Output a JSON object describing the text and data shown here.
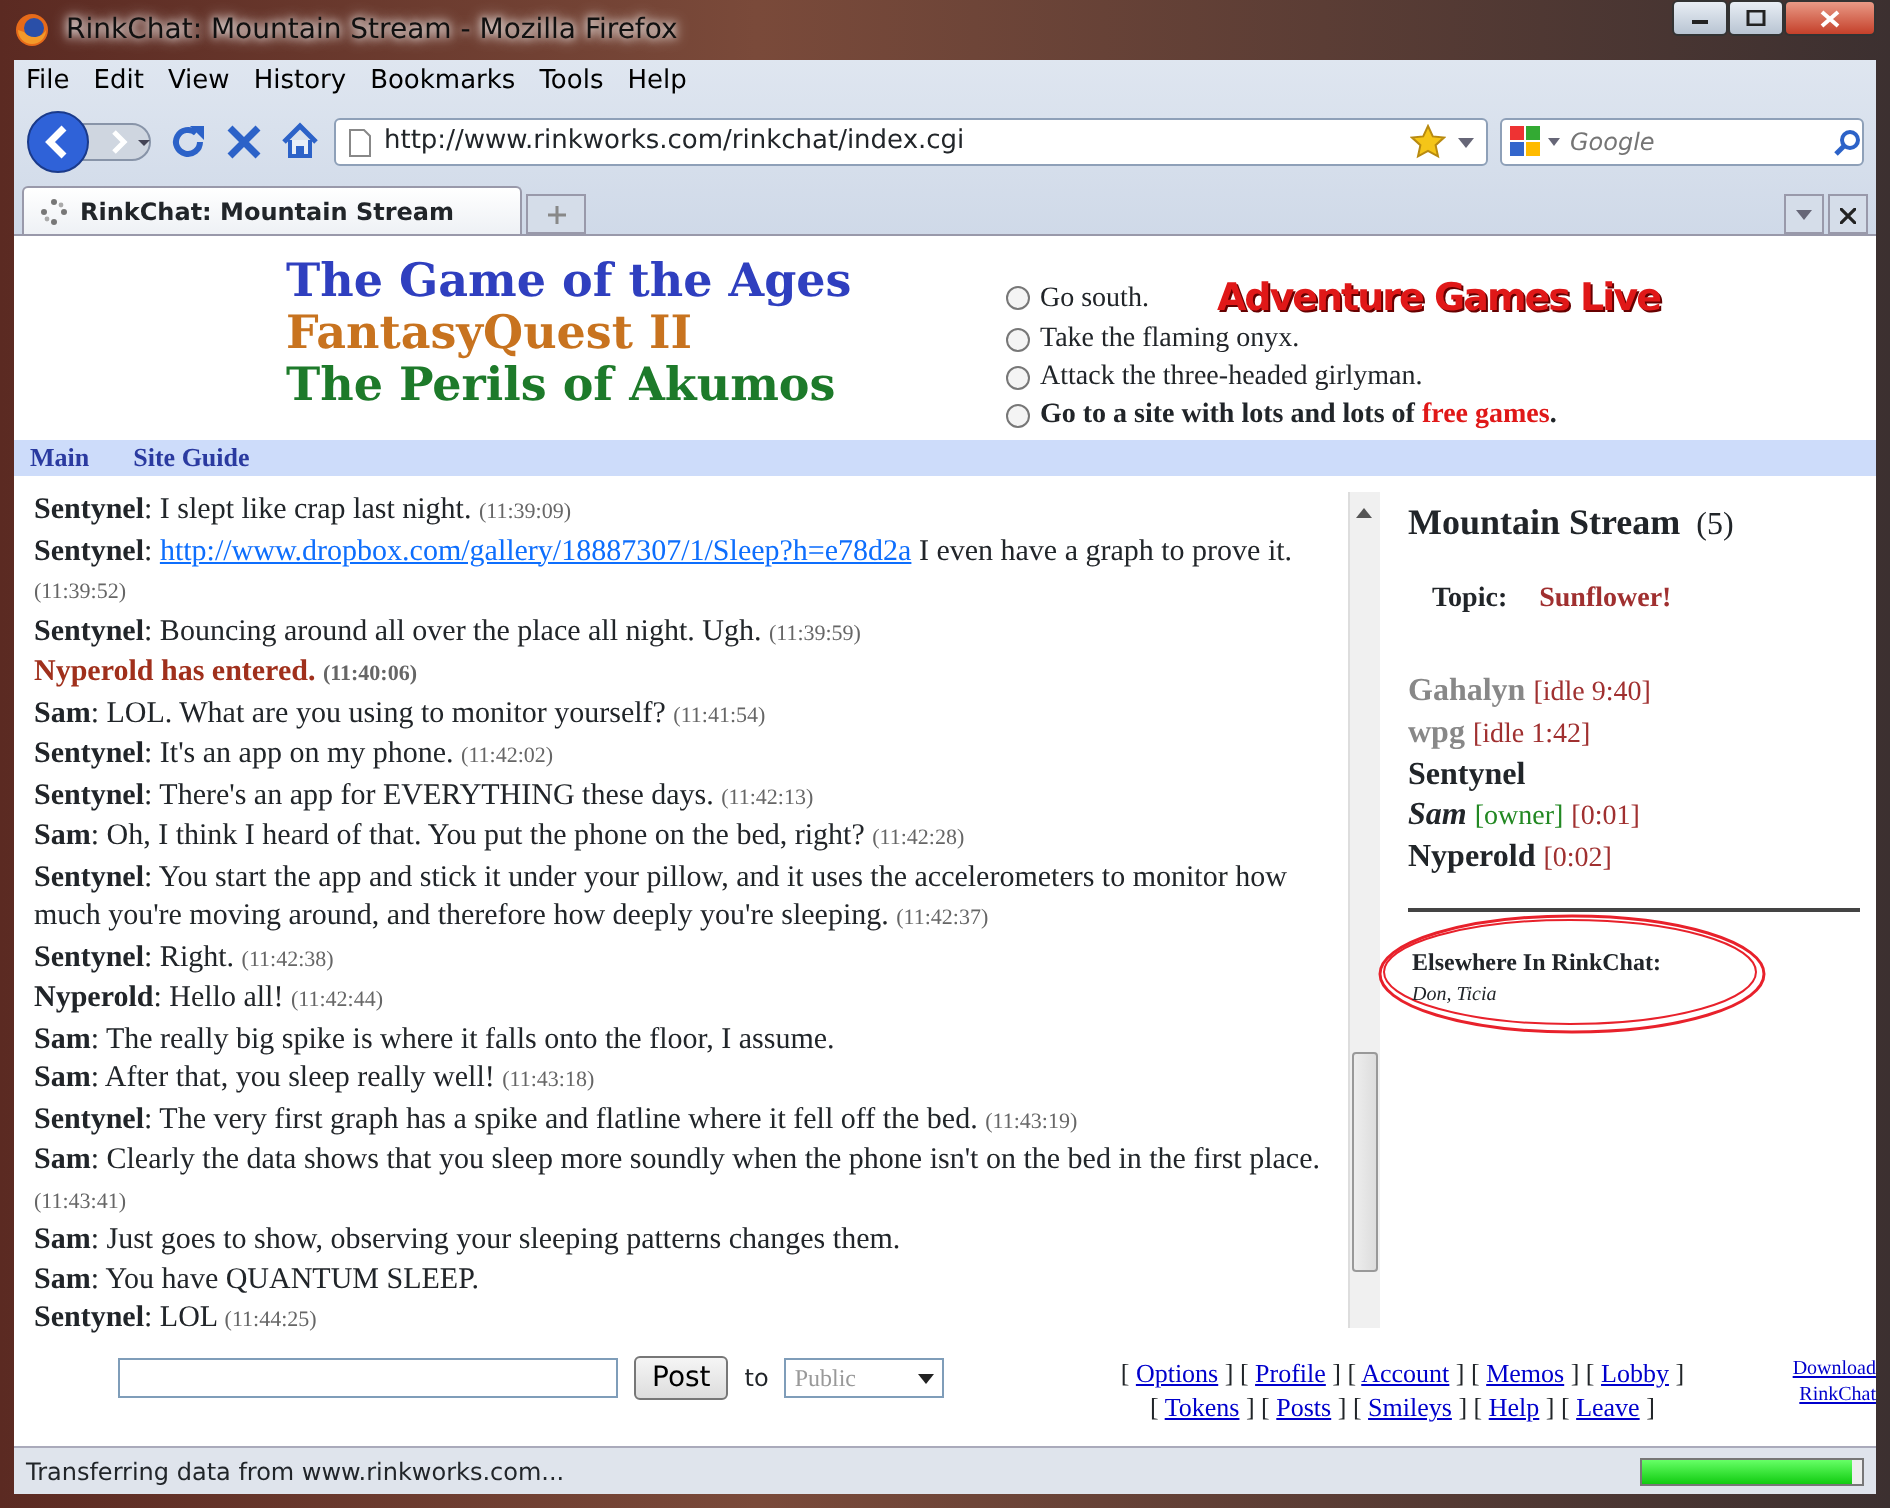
{
  "window": {
    "title": "RinkChat: Mountain Stream - Mozilla Firefox"
  },
  "menu": [
    "File",
    "Edit",
    "View",
    "History",
    "Bookmarks",
    "Tools",
    "Help"
  ],
  "address": {
    "url": "http://www.rinkworks.com/rinkchat/index.cgi"
  },
  "search": {
    "placeholder": "Google"
  },
  "tabs": [
    {
      "label": "RinkChat: Mountain Stream",
      "selected": true
    }
  ],
  "header": {
    "logo_lines": [
      {
        "text": "The Game of the Ages",
        "color": "#2f3fbf"
      },
      {
        "text": "FantasyQuest II",
        "color": "#c8731f"
      },
      {
        "text": "The Perils of Akumos",
        "color": "#1d7a2a"
      }
    ],
    "options": [
      {
        "text": "Go south.",
        "checked": false,
        "bold": false
      },
      {
        "text": "Take the flaming onyx.",
        "checked": false,
        "bold": false
      },
      {
        "text": "Attack the three-headed girlyman.",
        "checked": false,
        "bold": false
      },
      {
        "text": "Go to a site with lots and lots of **free games**.",
        "checked": false,
        "bold": true
      }
    ],
    "banner": "Adventure Games Live"
  },
  "site_nav": [
    "Main",
    "Site Guide"
  ],
  "chat": [
    {
      "kind": "message",
      "speaker": "Sentynel",
      "text": ": I slept like crap last night.",
      "time": "(11:39:09)"
    },
    {
      "kind": "message",
      "speaker": "Sentynel",
      "text": ":",
      "link": "http://www.dropbox.com/gallery/18887307/1/Sleep?h=e78d2a",
      "after": " I even have a graph to prove it.",
      "time": "(11:39:52)"
    },
    {
      "kind": "message",
      "speaker": "Sentynel",
      "text": ": Bouncing around all over the place all night. Ugh.",
      "time": "(11:39:59)"
    },
    {
      "kind": "event",
      "text": "Nyperold has entered.",
      "time": "(11:40:06)"
    },
    {
      "kind": "message",
      "speaker": "Sam",
      "text": ": LOL. What are you using to monitor yourself?",
      "time": "(11:41:54)"
    },
    {
      "kind": "message",
      "speaker": "Sentynel",
      "text": ": It's an app on my phone.",
      "time": "(11:42:02)"
    },
    {
      "kind": "message",
      "speaker": "Sentynel",
      "text": ": There's an app for EVERYTHING these days.",
      "time": "(11:42:13)"
    },
    {
      "kind": "message",
      "speaker": "Sam",
      "text": ": Oh, I think I heard of that. You put the phone on the bed, right?",
      "time": "(11:42:28)"
    },
    {
      "kind": "message",
      "speaker": "Sentynel",
      "text": ": You start the app and stick it under your pillow, and it uses the accelerometers to monitor how much you're moving around, and therefore how deeply you're sleeping.",
      "time": "(11:42:37)"
    },
    {
      "kind": "message",
      "speaker": "Sentynel",
      "text": ": Right.",
      "time": "(11:42:38)"
    },
    {
      "kind": "message",
      "speaker": "Nyperold",
      "text": ": Hello all!",
      "time": "(11:42:44)"
    },
    {
      "kind": "message",
      "speaker": "Sam",
      "text": ": The really big spike is where it falls onto the floor, I assume."
    },
    {
      "kind": "message",
      "speaker": "Sam",
      "text": ": After that, you sleep really well!",
      "time": "(11:43:18)"
    },
    {
      "kind": "message",
      "speaker": "Sentynel",
      "text": ": The very first graph has a spike and flatline where it fell off the bed.",
      "time": "(11:43:19)"
    },
    {
      "kind": "message",
      "speaker": "Sam",
      "text": ": Clearly the data shows that you sleep more soundly when the phone isn't on the bed in the first place.",
      "time": "(11:43:41)"
    },
    {
      "kind": "message",
      "speaker": "Sam",
      "text": ": Just goes to show, observing your sleeping patterns changes them."
    },
    {
      "kind": "message",
      "speaker": "Sam",
      "text": ": You have QUANTUM SLEEP."
    },
    {
      "kind": "message",
      "speaker": "Sentynel",
      "text": ": LOL",
      "time": "(11:44:25)"
    }
  ],
  "room": {
    "name": "Mountain Stream",
    "count": "(5)",
    "topic_label": "Topic:",
    "topic": "Sunflower!",
    "users": [
      {
        "name": "Gahalyn",
        "idle": true,
        "owner": false,
        "tags": [
          {
            "kind": "time",
            "text": "[idle 9:40]"
          }
        ]
      },
      {
        "name": "wpg",
        "idle": true,
        "owner": false,
        "tags": [
          {
            "kind": "time",
            "text": "[idle 1:42]"
          }
        ]
      },
      {
        "name": "Sentynel",
        "idle": false,
        "owner": false
      },
      {
        "name": "Sam",
        "idle": false,
        "owner": true,
        "tags": [
          {
            "kind": "role",
            "text": "[owner]"
          },
          {
            "kind": "time",
            "text": "[0:01]"
          }
        ]
      },
      {
        "name": "Nyperold",
        "idle": false,
        "owner": false,
        "tags": [
          {
            "kind": "time",
            "text": "[0:02]"
          }
        ]
      }
    ],
    "elsewhere_title": "Elsewhere In RinkChat:",
    "elsewhere": "Don, Ticia"
  },
  "form": {
    "button": "Post",
    "to": "to",
    "recipient": "Public"
  },
  "links": [
    [
      {
        "text": "["
      },
      {
        "link": "Options"
      },
      {
        "text": "] ["
      },
      {
        "link": "Profile"
      },
      {
        "text": "] ["
      },
      {
        "link": "Account"
      },
      {
        "text": "] ["
      },
      {
        "link": "Memos"
      },
      {
        "text": "] ["
      },
      {
        "link": "Lobby"
      },
      {
        "text": "]"
      }
    ],
    [
      {
        "text": "["
      },
      {
        "link": "Tokens"
      },
      {
        "text": "] ["
      },
      {
        "link": "Posts"
      },
      {
        "text": "] ["
      },
      {
        "link": "Smileys"
      },
      {
        "text": "] ["
      },
      {
        "link": "Help"
      },
      {
        "text": "] ["
      },
      {
        "link": "Leave"
      },
      {
        "text": "]"
      }
    ]
  ],
  "download": "Download RinkChat",
  "status_bar": {
    "text": "Transferring data from www.rinkworks.com...",
    "level": 0.95
  }
}
